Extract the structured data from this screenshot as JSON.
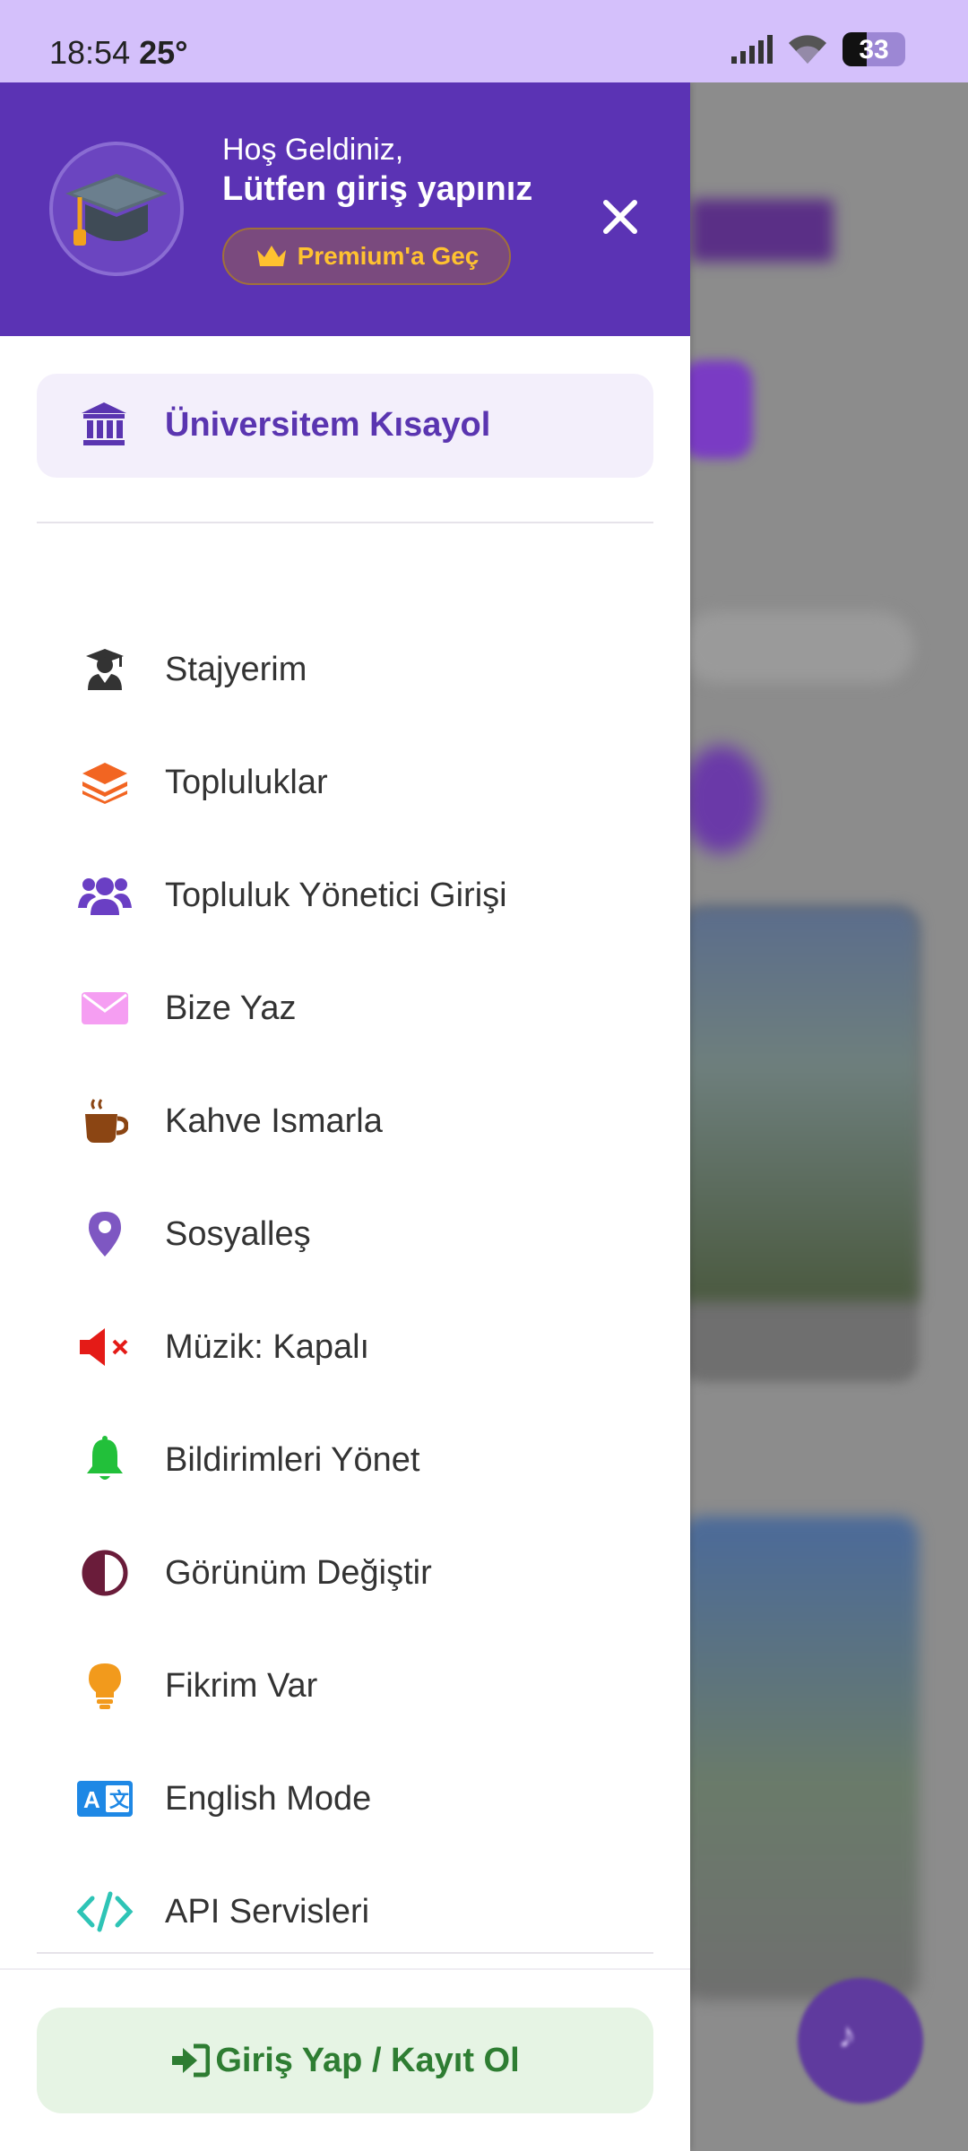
{
  "status_bar": {
    "time": "18:54",
    "temperature": "25°",
    "battery": "33"
  },
  "header": {
    "welcome": "Hoş Geldiniz,",
    "login_prompt": "Lütfen giriş yapınız",
    "premium_label": "Premium'a Geç"
  },
  "shortcut": {
    "label": "Üniversitem Kısayol",
    "icon": "university-icon"
  },
  "menu": {
    "items": [
      {
        "label": "Stajyerim",
        "icon": "graduate-icon",
        "color": "#333333"
      },
      {
        "label": "Topluluklar",
        "icon": "layers-icon",
        "color": "#f26522"
      },
      {
        "label": "Topluluk Yönetici Girişi",
        "icon": "users-icon",
        "color": "#6a3fc4"
      },
      {
        "label": "Bize Yaz",
        "icon": "envelope-icon",
        "color": "#f59ef2"
      },
      {
        "label": "Kahve Ismarla",
        "icon": "coffee-icon",
        "color": "#8b4513"
      },
      {
        "label": "Sosyalleş",
        "icon": "location-pin-icon",
        "color": "#7e57c2"
      },
      {
        "label": "Müzik: Kapalı",
        "icon": "volume-mute-icon",
        "color": "#e41b17"
      },
      {
        "label": "Bildirimleri Yönet",
        "icon": "bell-icon",
        "color": "#22c03a"
      },
      {
        "label": "Görünüm Değiştir",
        "icon": "contrast-icon",
        "color": "#6a1c3a"
      },
      {
        "label": "Fikrim Var",
        "icon": "lightbulb-icon",
        "color": "#f29a1c"
      },
      {
        "label": "English Mode",
        "icon": "translate-icon",
        "color": "#1e88e5"
      },
      {
        "label": "API Servisleri",
        "icon": "code-icon",
        "color": "#2ec4b6"
      }
    ]
  },
  "footer": {
    "login_label": "Giriş Yap / Kayıt Ol"
  }
}
